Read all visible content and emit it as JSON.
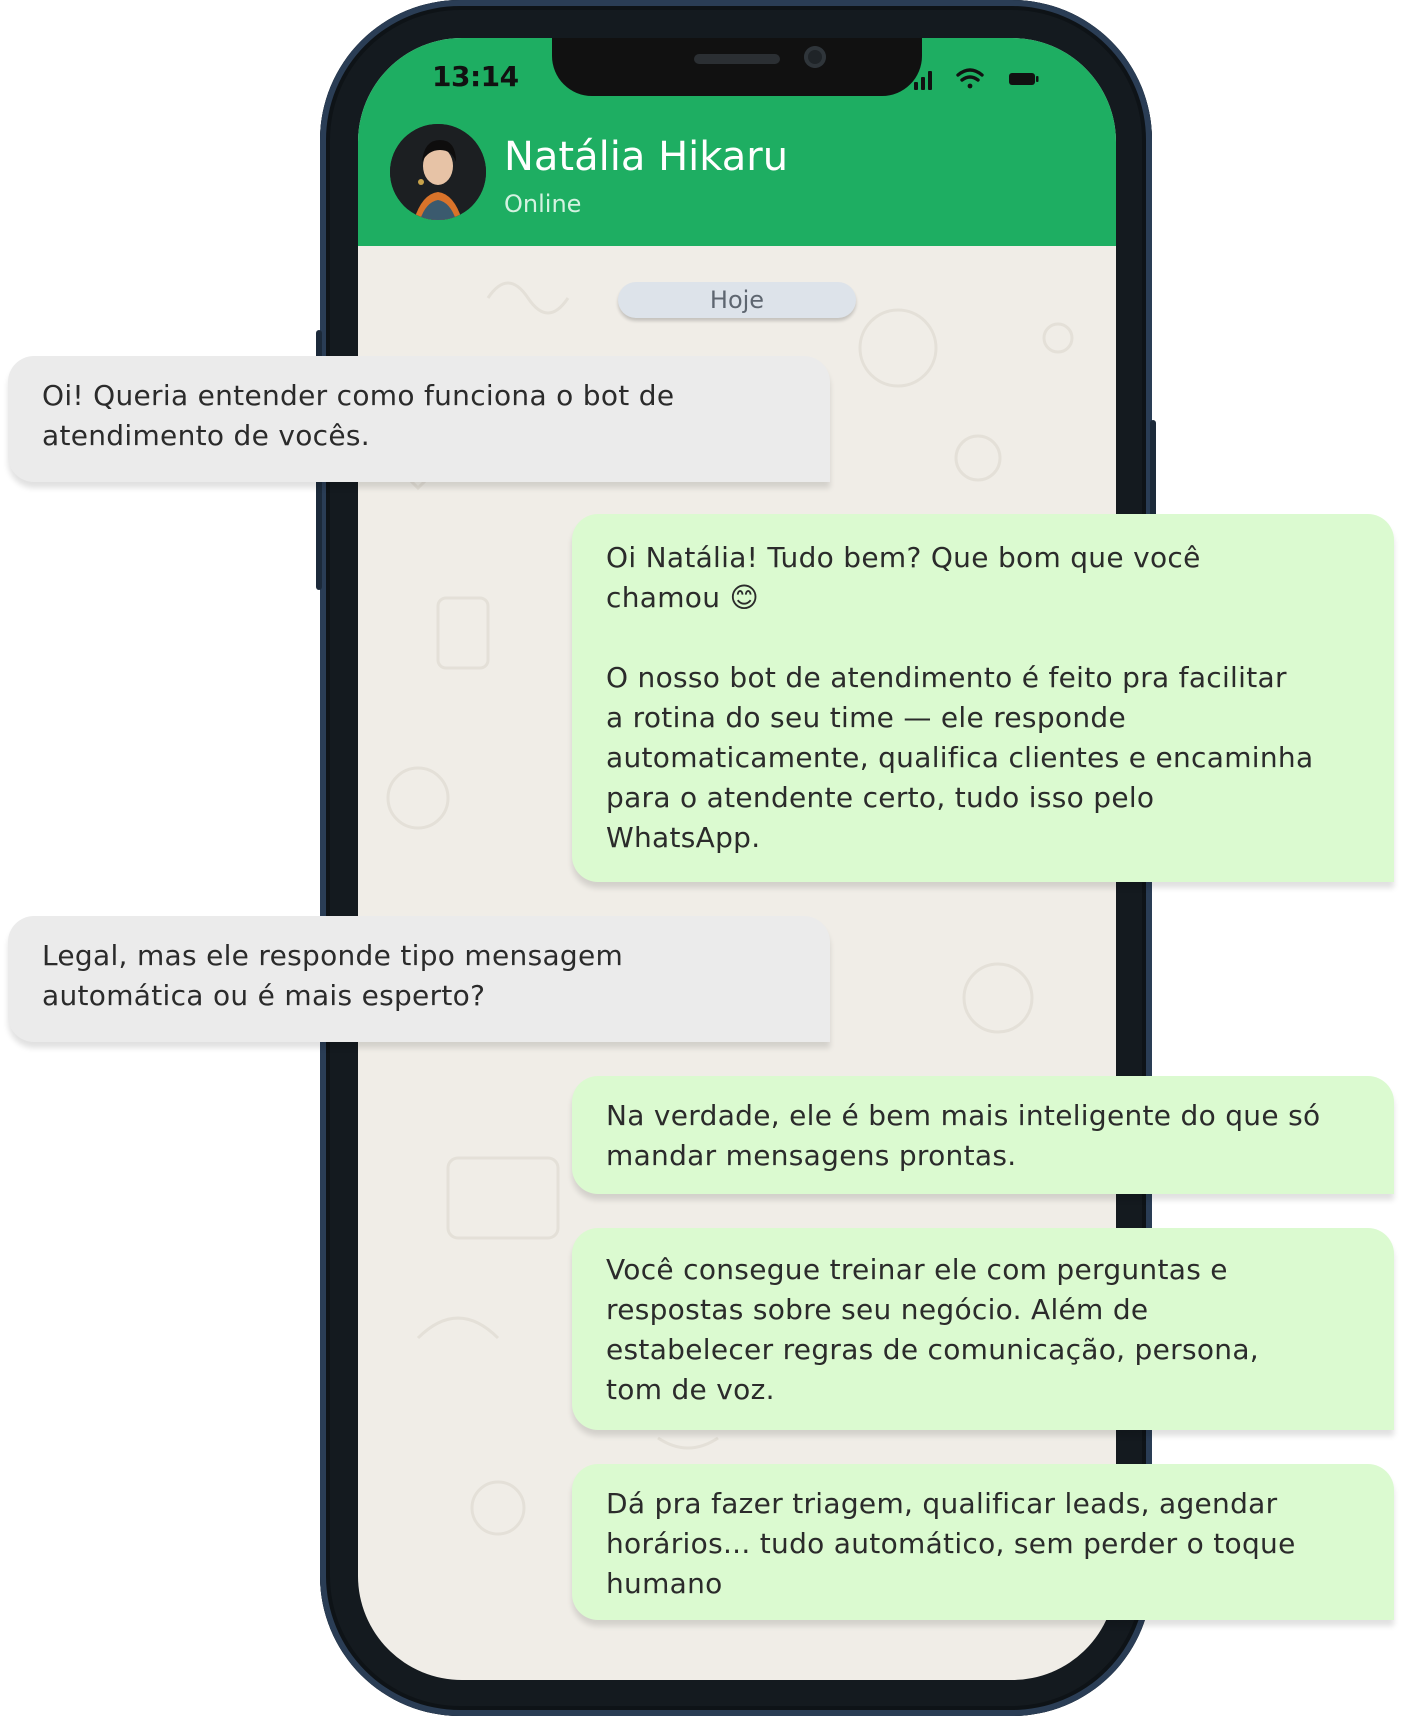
{
  "status_bar": {
    "time": "13:14",
    "icons": [
      "signal-icon",
      "wifi-icon",
      "battery-icon"
    ]
  },
  "header": {
    "contact_name": "Natália Hikaru",
    "contact_status": "Online",
    "avatar": "contact-avatar",
    "color": "#1eae62"
  },
  "date_separator": "Hoje",
  "colors": {
    "incoming_bubble": "#ebebeb",
    "outgoing_bubble": "#dbfad0",
    "chat_background": "#f0ede7"
  },
  "messages": [
    {
      "direction": "incoming",
      "text": "Oi! Queria entender como funciona o bot de\natendimento de vocês."
    },
    {
      "direction": "outgoing",
      "text": "Oi Natália! Tudo bem? Que bom que você\nchamou 😊\n\nO nosso bot de atendimento é feito pra facilitar\na rotina do seu time — ele responde\nautomaticamente, qualifica clientes e encaminha\npara o atendente certo, tudo isso pelo\nWhatsApp."
    },
    {
      "direction": "incoming",
      "text": "Legal, mas ele responde tipo mensagem\nautomática ou é mais esperto?"
    },
    {
      "direction": "outgoing",
      "text": "Na verdade, ele é bem mais inteligente do que só\nmandar mensagens prontas."
    },
    {
      "direction": "outgoing",
      "text": "Você consegue treinar ele com perguntas e\nrespostas sobre seu negócio. Além de\nestabelecer regras de comunicação, persona,\ntom de voz."
    },
    {
      "direction": "outgoing",
      "text": "Dá pra fazer triagem, qualificar leads, agendar\nhorários... tudo automático, sem perder o toque\nhumano"
    }
  ]
}
